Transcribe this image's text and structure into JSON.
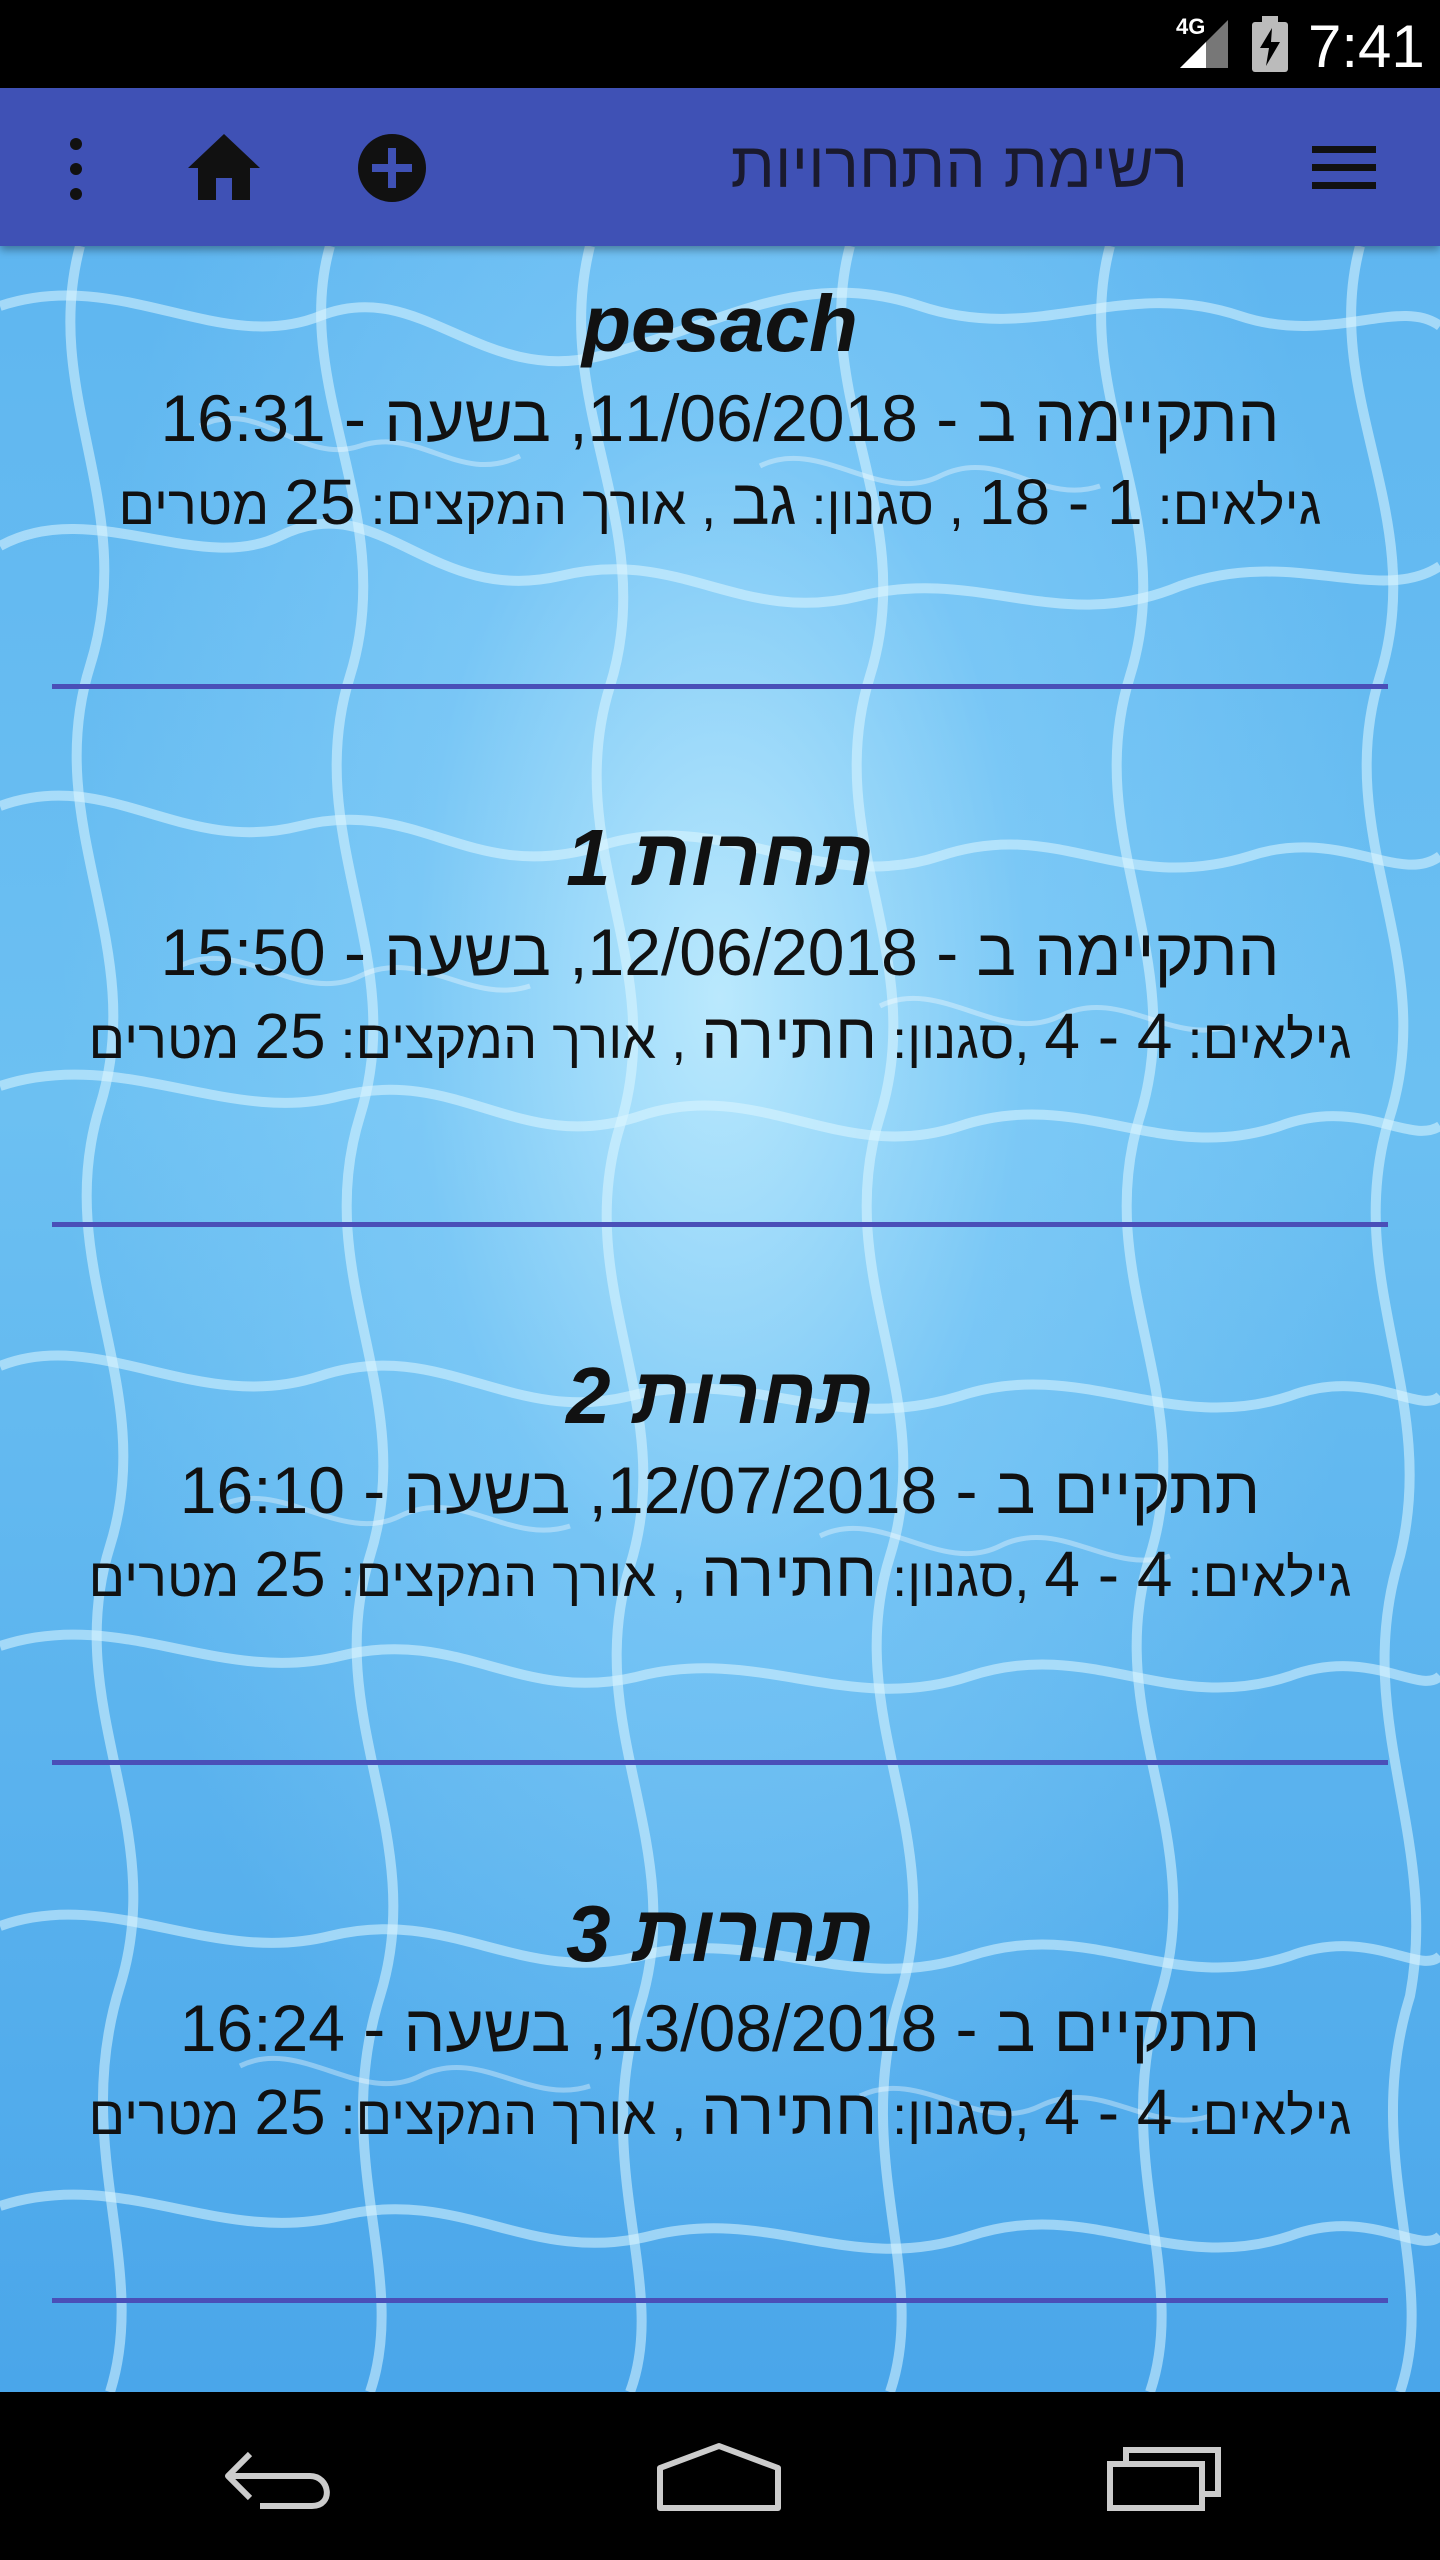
{
  "status_bar": {
    "network": "4G",
    "time": "7:41"
  },
  "app_bar": {
    "title": "רשימת התחרויות",
    "icons": [
      "menu-icon",
      "add-circle-icon",
      "home-icon",
      "more-vert-icon"
    ]
  },
  "competitions": [
    {
      "name": "pesach",
      "when": "התקיימה ב - 11/06/2018, בשעה - 16:31",
      "ages_label": "גילאים:",
      "ages": "1 - 18",
      "style_label": ", סגנון:",
      "style": "גב",
      "length_label": ", אורך המקצים:",
      "length": "25",
      "unit": "מטרים"
    },
    {
      "name": "תחרות 1",
      "when": "התקיימה ב - 12/06/2018, בשעה - 15:50",
      "ages_label": "גילאים:",
      "ages": "4 - 4",
      "style_label": ",סגנון:",
      "style": "חתירה",
      "length_label": ", אורך המקצים:",
      "length": "25",
      "unit": "מטרים"
    },
    {
      "name": "תחרות 2",
      "when": "תתקיים ב - 12/07/2018, בשעה - 16:10",
      "ages_label": "גילאים:",
      "ages": "4 - 4",
      "style_label": ",סגנון:",
      "style": "חתירה",
      "length_label": ", אורך המקצים:",
      "length": "25",
      "unit": "מטרים"
    },
    {
      "name": "תחרות 3",
      "when": "תתקיים ב - 13/08/2018, בשעה - 16:24",
      "ages_label": "גילאים:",
      "ages": "4 - 4",
      "style_label": ",סגנון:",
      "style": "חתירה",
      "length_label": ", אורך המקצים:",
      "length": "25",
      "unit": "מטרים"
    }
  ],
  "colors": {
    "app_bar": "#3f51b5",
    "divider": "#4a4fb8",
    "background": "#6cc0f2"
  },
  "nav_bar": {
    "icons": [
      "back-icon",
      "home-nav-icon",
      "recents-icon"
    ]
  }
}
